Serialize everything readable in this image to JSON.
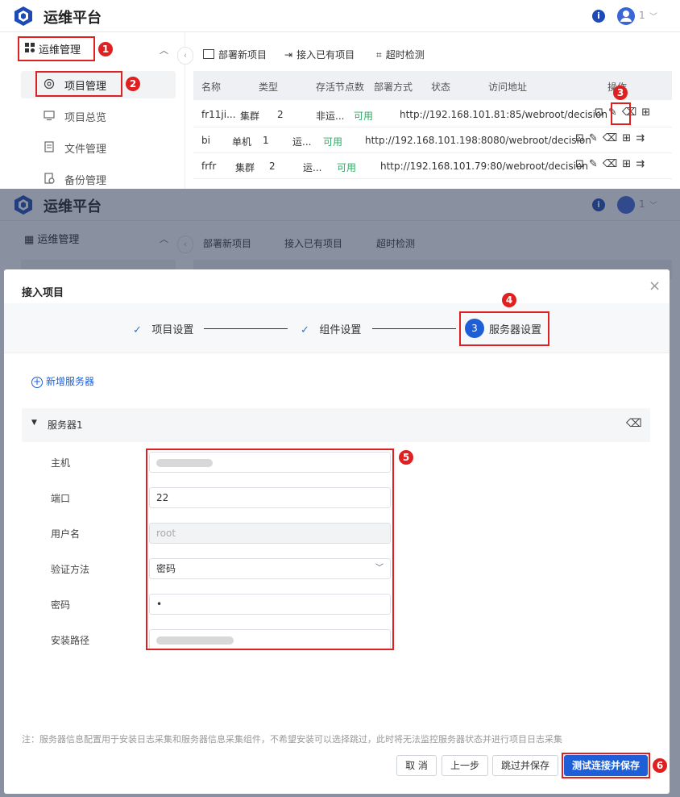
{
  "app": {
    "title": "运维平台",
    "info": "i",
    "user_num": "1"
  },
  "sidebar": {
    "group": "运维管理",
    "items": [
      "项目管理",
      "项目总览",
      "文件管理",
      "备份管理"
    ]
  },
  "toolbar": {
    "deploy": "部署新项目",
    "connect": "接入已有项目",
    "timeout": "超时检测"
  },
  "table": {
    "headers": [
      "名称",
      "类型",
      "存活节点数",
      "部署方式",
      "状态",
      "访问地址",
      "操作"
    ],
    "rows": [
      {
        "name": "fr11ji...",
        "type": "集群",
        "nodes": "2",
        "deploy": "非运...",
        "status": "可用",
        "url": "http://192.168.101.81:85/webroot/decision"
      },
      {
        "name": "bi",
        "type": "单机",
        "nodes": "1",
        "deploy": "运...",
        "status": "可用",
        "url": "http://192.168.101.198:8080/webroot/decision"
      },
      {
        "name": "frfr",
        "type": "集群",
        "nodes": "2",
        "deploy": "运...",
        "status": "可用",
        "url": "http://192.168.101.79:80/webroot/decision"
      }
    ]
  },
  "modal": {
    "title": "接入项目",
    "close": "×",
    "steps": [
      {
        "label": "项目设置",
        "mark": "✓"
      },
      {
        "label": "组件设置",
        "mark": "✓"
      },
      {
        "label": "服务器设置",
        "num": "3"
      }
    ],
    "add_server": "新增服务器",
    "server_title": "服务器1",
    "fields": {
      "host_label": "主机",
      "port_label": "端口",
      "port_value": "22",
      "user_label": "用户名",
      "user_value": "root",
      "auth_label": "验证方法",
      "auth_value": "密码",
      "pwd_label": "密码",
      "pwd_value": "•",
      "path_label": "安装路径"
    },
    "note": "注：服务器信息配置用于安装日志采集和服务器信息采集组件，不希望安装可以选择跳过，此时将无法监控服务器状态并进行项目日志采集",
    "buttons": {
      "cancel": "取 消",
      "prev": "上一步",
      "skip": "跳过并保存",
      "test": "测试连接并保存"
    }
  },
  "badges": [
    "1",
    "2",
    "3",
    "4",
    "5",
    "6"
  ]
}
